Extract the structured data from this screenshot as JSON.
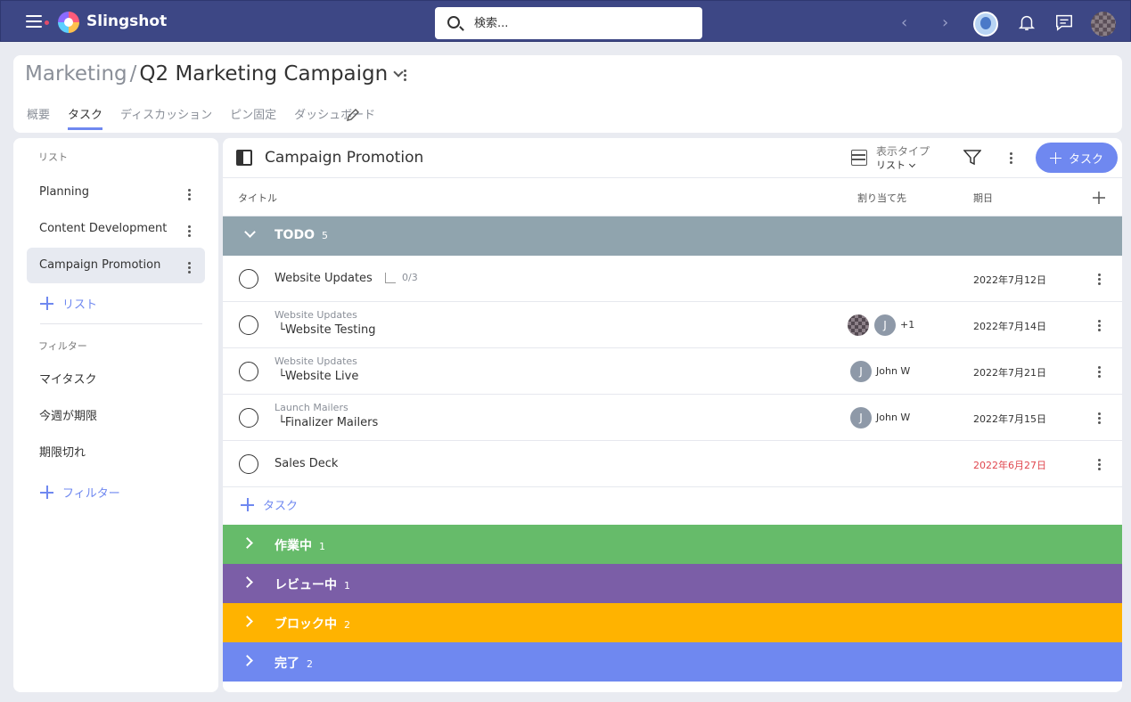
{
  "app": {
    "brand": "Slingshot",
    "search_placeholder": "検索..."
  },
  "header": {
    "breadcrumb_parent": "Marketing",
    "breadcrumb_sep": "/",
    "breadcrumb_current": "Q2 Marketing Campaign",
    "tabs": [
      {
        "label": "概要"
      },
      {
        "label": "タスク"
      },
      {
        "label": "ディスカッション"
      },
      {
        "label": "ピン固定"
      },
      {
        "label": "ダッシュボード"
      }
    ]
  },
  "sidebar": {
    "lists_label": "リスト",
    "lists": [
      {
        "label": "Planning"
      },
      {
        "label": "Content Development"
      },
      {
        "label": "Campaign Promotion"
      }
    ],
    "add_list_label": "リスト",
    "filters_label": "フィルター",
    "filters": [
      {
        "label": "マイタスク"
      },
      {
        "label": "今週が期限"
      },
      {
        "label": "期限切れ"
      }
    ],
    "add_filter_label": "フィルター"
  },
  "main": {
    "title": "Campaign Promotion",
    "view_type_label": "表示タイプ",
    "view_type_value": "リスト",
    "add_task_button": "タスク",
    "columns": {
      "title": "タイトル",
      "assignee": "割り当て先",
      "due": "期日"
    },
    "groups": [
      {
        "name": "TODO",
        "count": "5",
        "color": "#90a4ae",
        "expanded": true
      },
      {
        "name": "作業中",
        "count": "1",
        "color": "#66bb6a",
        "expanded": false
      },
      {
        "name": "レビュー中",
        "count": "1",
        "color": "#7b5ea7",
        "expanded": false
      },
      {
        "name": "ブロック中",
        "count": "2",
        "color": "#ffb300",
        "expanded": false
      },
      {
        "name": "完了",
        "count": "2",
        "color": "#6f88f0",
        "expanded": false
      }
    ],
    "tasks": [
      {
        "name": "Website Updates",
        "parent": "",
        "subtasks": "0/3",
        "assignees": [],
        "assignee_name": "",
        "extra": "",
        "due": "2022年7月12日",
        "overdue": false
      },
      {
        "name": "└Website Testing",
        "parent": "Website Updates",
        "subtasks": "",
        "assignees": [
          "photo",
          "J"
        ],
        "assignee_name": "",
        "extra": "+1",
        "due": "2022年7月14日",
        "overdue": false
      },
      {
        "name": "└Website Live",
        "parent": "Website Updates",
        "subtasks": "",
        "assignees": [
          "J"
        ],
        "assignee_name": "John W",
        "extra": "",
        "due": "2022年7月21日",
        "overdue": false
      },
      {
        "name": "└Finalizer Mailers",
        "parent": "Launch Mailers",
        "subtasks": "",
        "assignees": [
          "J"
        ],
        "assignee_name": "John W",
        "extra": "",
        "due": "2022年7月15日",
        "overdue": false
      },
      {
        "name": "Sales Deck",
        "parent": "",
        "subtasks": "",
        "assignees": [],
        "assignee_name": "",
        "extra": "",
        "due": "2022年6月27日",
        "overdue": true
      }
    ],
    "add_task_link": "タスク",
    "avatar_initial": "J"
  }
}
